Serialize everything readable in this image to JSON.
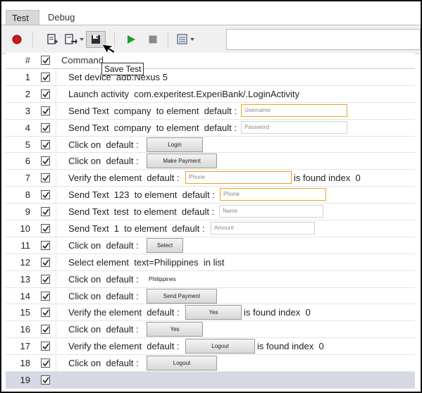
{
  "tabs": [
    "Test",
    "Debug"
  ],
  "tooltip": "Save Test",
  "toolbar": {
    "icons": [
      "record-icon",
      "new-document-icon",
      "export-dropdown-icon",
      "save-test-icon",
      "play-icon",
      "stop-icon",
      "options-dropdown-icon"
    ],
    "record_color": "#d11818",
    "play_color": "#1e9e2e"
  },
  "table": {
    "headers": {
      "num": "#",
      "command": "Command"
    },
    "rows": [
      {
        "num": "1",
        "text": "Set device  adb:Nexus 5"
      },
      {
        "num": "2",
        "text": "Launch activity  com.experitest.ExperiBank/.LoginActivity"
      },
      {
        "num": "3",
        "text": "Send Text  company  to element  default :",
        "element": "Username"
      },
      {
        "num": "4",
        "text": "Send Text  company  to element  default :",
        "element": "Password"
      },
      {
        "num": "5",
        "text": "Click on  default :",
        "element": "Login"
      },
      {
        "num": "6",
        "text": "Click on  default :",
        "element": "Make Payment"
      },
      {
        "num": "7",
        "text": "Verify the element  default :",
        "element": "Phone",
        "suffix": "is found index  0"
      },
      {
        "num": "8",
        "text": "Send Text  123  to element  default :",
        "element": "Phone"
      },
      {
        "num": "9",
        "text": "Send Text  test  to element  default :",
        "element": "Name"
      },
      {
        "num": "10",
        "text": "Send Text  1  to element  default :",
        "element": "Amount"
      },
      {
        "num": "11",
        "text": "Click on  default :",
        "element": "Select"
      },
      {
        "num": "12",
        "text": "Select element  text=Philippines  in list"
      },
      {
        "num": "13",
        "text": "Click on  default :",
        "element": "Philippines"
      },
      {
        "num": "14",
        "text": "Click on  default :",
        "element": "Send Payment"
      },
      {
        "num": "15",
        "text": "Verify the element  default :",
        "element": "Yes",
        "suffix": "is found index  0"
      },
      {
        "num": "16",
        "text": "Click on  default :",
        "element": "Yes"
      },
      {
        "num": "17",
        "text": "Verify the element  default :",
        "element": "Logout",
        "suffix": "is found index  0"
      },
      {
        "num": "18",
        "text": "Click on  default :",
        "element": "Logout"
      },
      {
        "num": "19",
        "text": ""
      }
    ]
  }
}
